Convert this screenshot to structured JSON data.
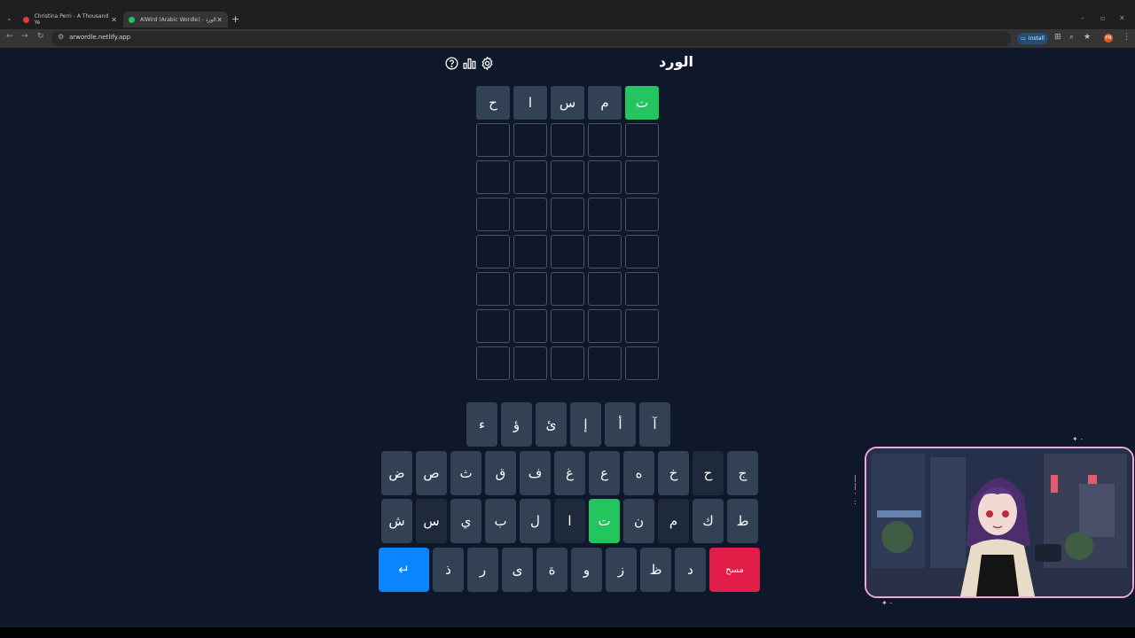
{
  "browser": {
    "tabs": [
      {
        "title": "Christina Perri - A Thousand Ye",
        "favicon_color": "#e53935"
      },
      {
        "title": "AlWird (Arabic Wordle) - الورد",
        "favicon_color": "#22c55e"
      }
    ],
    "url": "arwordle.netlify.app",
    "install_label": "Install",
    "profile_initials": "PN"
  },
  "app": {
    "title": "الورد",
    "icons": [
      "help-icon",
      "stats-icon",
      "settings-icon"
    ]
  },
  "board": {
    "rows": [
      [
        {
          "letter": "ح",
          "state": "filled"
        },
        {
          "letter": "ا",
          "state": "filled"
        },
        {
          "letter": "س",
          "state": "filled"
        },
        {
          "letter": "م",
          "state": "filled"
        },
        {
          "letter": "ت",
          "state": "correct"
        }
      ],
      [
        {
          "letter": ""
        },
        {
          "letter": ""
        },
        {
          "letter": ""
        },
        {
          "letter": ""
        },
        {
          "letter": ""
        }
      ],
      [
        {
          "letter": ""
        },
        {
          "letter": ""
        },
        {
          "letter": ""
        },
        {
          "letter": ""
        },
        {
          "letter": ""
        }
      ],
      [
        {
          "letter": ""
        },
        {
          "letter": ""
        },
        {
          "letter": ""
        },
        {
          "letter": ""
        },
        {
          "letter": ""
        }
      ],
      [
        {
          "letter": ""
        },
        {
          "letter": ""
        },
        {
          "letter": ""
        },
        {
          "letter": ""
        },
        {
          "letter": ""
        }
      ],
      [
        {
          "letter": ""
        },
        {
          "letter": ""
        },
        {
          "letter": ""
        },
        {
          "letter": ""
        },
        {
          "letter": ""
        }
      ],
      [
        {
          "letter": ""
        },
        {
          "letter": ""
        },
        {
          "letter": ""
        },
        {
          "letter": ""
        },
        {
          "letter": ""
        }
      ],
      [
        {
          "letter": ""
        },
        {
          "letter": ""
        },
        {
          "letter": ""
        },
        {
          "letter": ""
        },
        {
          "letter": ""
        }
      ]
    ]
  },
  "keyboard": {
    "row1": [
      {
        "label": "ء"
      },
      {
        "label": "ؤ"
      },
      {
        "label": "ئ"
      },
      {
        "label": "إ"
      },
      {
        "label": "أ"
      },
      {
        "label": "آ"
      }
    ],
    "row2": [
      {
        "label": "ض"
      },
      {
        "label": "ص"
      },
      {
        "label": "ث"
      },
      {
        "label": "ق"
      },
      {
        "label": "ف"
      },
      {
        "label": "غ"
      },
      {
        "label": "ع"
      },
      {
        "label": "ه"
      },
      {
        "label": "خ"
      },
      {
        "label": "ح",
        "state": "absent"
      },
      {
        "label": "ج"
      }
    ],
    "row3": [
      {
        "label": "ش"
      },
      {
        "label": "س",
        "state": "absent"
      },
      {
        "label": "ي"
      },
      {
        "label": "ب"
      },
      {
        "label": "ل"
      },
      {
        "label": "ا",
        "state": "absent"
      },
      {
        "label": "ت",
        "state": "correct"
      },
      {
        "label": "ن"
      },
      {
        "label": "م",
        "state": "absent"
      },
      {
        "label": "ك"
      },
      {
        "label": "ط"
      }
    ],
    "row4": [
      {
        "label": "↵",
        "type": "enter"
      },
      {
        "label": "ذ"
      },
      {
        "label": "ر"
      },
      {
        "label": "ى"
      },
      {
        "label": "ة"
      },
      {
        "label": "و"
      },
      {
        "label": "ز"
      },
      {
        "label": "ظ"
      },
      {
        "label": "د"
      },
      {
        "label": "مسح",
        "type": "delete"
      }
    ]
  },
  "colors": {
    "background": "#0f172a",
    "correct": "#22c55e",
    "filled": "#334155",
    "absent": "#1e293b",
    "enter": "#0a84ff",
    "delete": "#e11d48",
    "overlay_border": "#f0a9d6"
  }
}
